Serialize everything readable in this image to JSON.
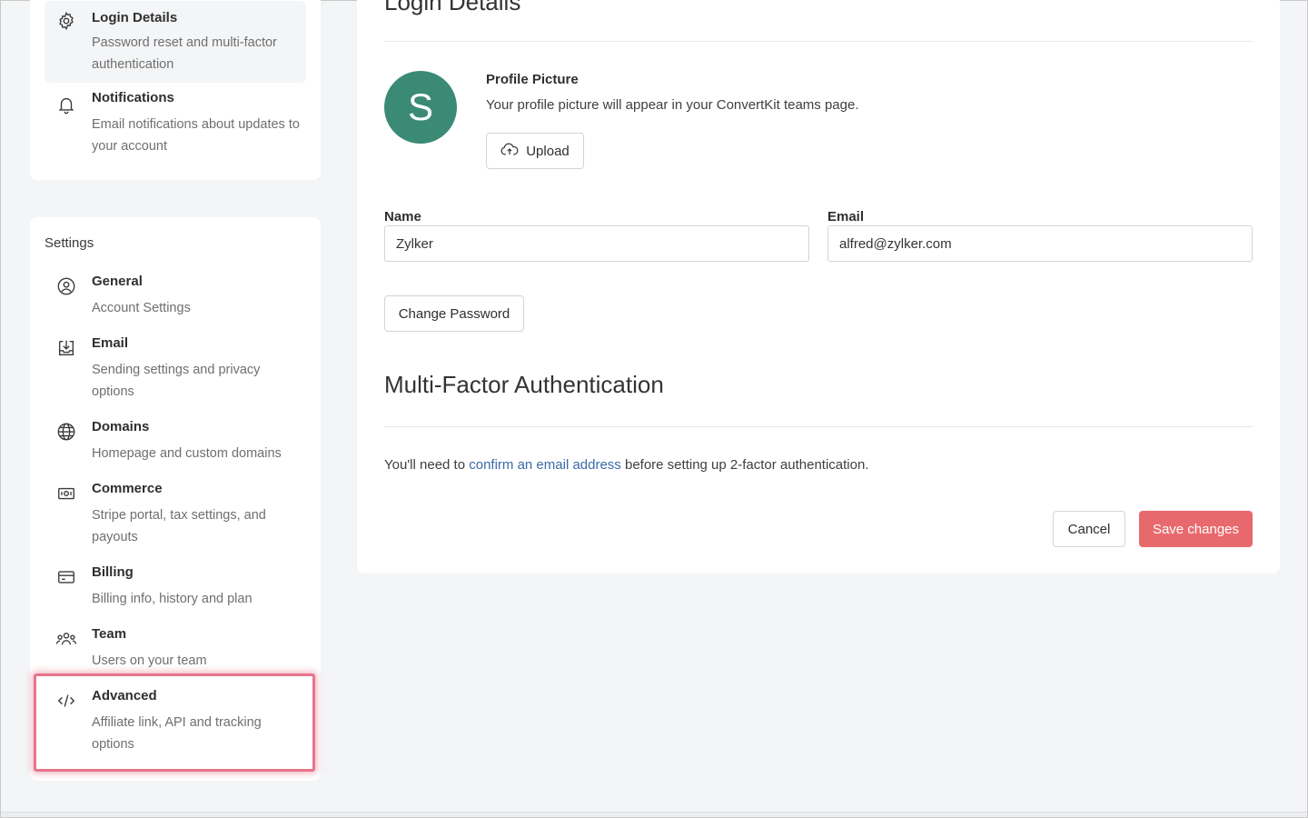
{
  "sidebar": {
    "top_items": [
      {
        "title": "Login Details",
        "desc": "Password reset and multi-factor authentication",
        "icon": "gear-icon"
      },
      {
        "title": "Notifications",
        "desc": "Email notifications about updates to your account",
        "icon": "bell-icon"
      }
    ],
    "settings_label": "Settings",
    "items": [
      {
        "title": "General",
        "desc": "Account Settings",
        "icon": "user-circle-icon"
      },
      {
        "title": "Email",
        "desc": "Sending settings and privacy options",
        "icon": "inbox-download-icon"
      },
      {
        "title": "Domains",
        "desc": "Homepage and custom domains",
        "icon": "globe-icon"
      },
      {
        "title": "Commerce",
        "desc": "Stripe portal, tax settings, and payouts",
        "icon": "cash-icon"
      },
      {
        "title": "Billing",
        "desc": "Billing info, history and plan",
        "icon": "credit-card-icon"
      },
      {
        "title": "Team",
        "desc": "Users on your team",
        "icon": "team-icon"
      },
      {
        "title": "Advanced",
        "desc": "Affiliate link, API and tracking options",
        "icon": "code-icon"
      }
    ]
  },
  "main": {
    "login_heading": "Login Details",
    "avatar_letter": "S",
    "profile_picture_title": "Profile Picture",
    "profile_picture_desc": "Your profile picture will appear in your ConvertKit teams page.",
    "upload_label": "Upload",
    "name_label": "Name",
    "name_value": "Zylker",
    "email_label": "Email",
    "email_value": "alfred@zylker.com",
    "change_password_label": "Change Password",
    "mfa_heading": "Multi-Factor Authentication",
    "mfa_text_before": "You'll need to ",
    "mfa_link": "confirm an email address",
    "mfa_text_after": " before setting up 2-factor authentication.",
    "cancel_label": "Cancel",
    "save_label": "Save changes"
  },
  "colors": {
    "accent": "#e8696d",
    "avatar": "#3b8a75",
    "link": "#3c6aa8",
    "highlight": "#e8748a"
  }
}
